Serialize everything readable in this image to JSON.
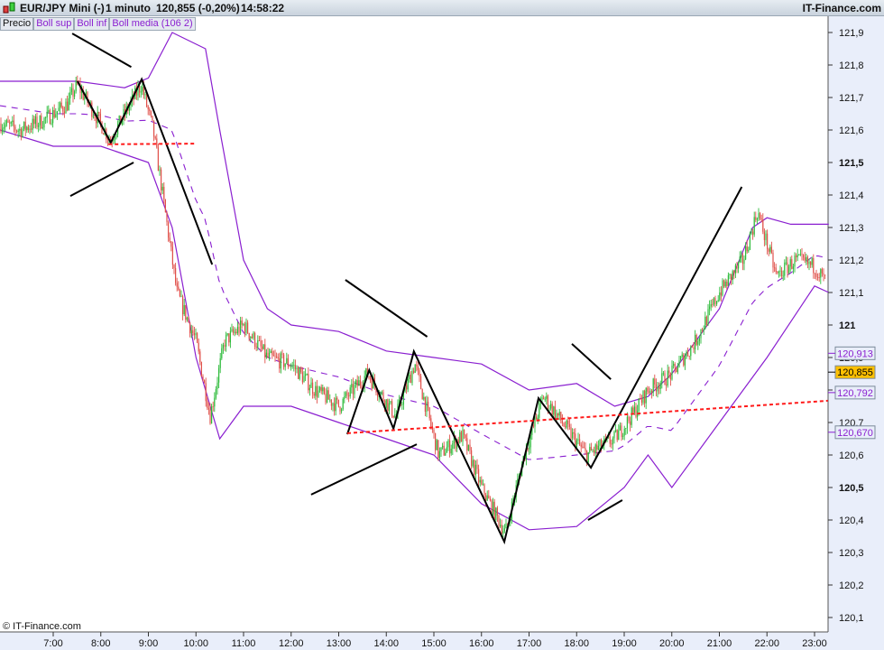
{
  "header": {
    "symbol": "EUR/JPY Mini (-)",
    "timeframe": "1 minuto",
    "price": "120,855 (-0,20%)",
    "time": "14:58:22",
    "brand": "IT-Finance.com"
  },
  "legend": [
    "Precio",
    "Boll sup",
    "Boll inf",
    "Boll media (106 2)"
  ],
  "footer": {
    "copyright": "© IT-Finance.com"
  },
  "colors": {
    "up": "#2dbb3a",
    "down": "#e0504a",
    "band": "#8a1fd0",
    "trend": "#000000",
    "support": "#ff1a1a",
    "last": "#ffc000"
  },
  "chart_data": {
    "type": "candlestick",
    "title": "EUR/JPY Mini (-) 1 minuto",
    "ylim": [
      120.05,
      121.95
    ],
    "xlim": [
      5.88,
      23.3
    ],
    "y_ticks": [
      {
        "v": 121.9,
        "label": "121,9"
      },
      {
        "v": 121.8,
        "label": "121,8"
      },
      {
        "v": 121.7,
        "label": "121,7"
      },
      {
        "v": 121.6,
        "label": "121,6"
      },
      {
        "v": 121.5,
        "label": "121,5",
        "bold": true
      },
      {
        "v": 121.4,
        "label": "121,4"
      },
      {
        "v": 121.3,
        "label": "121,3"
      },
      {
        "v": 121.2,
        "label": "121,2"
      },
      {
        "v": 121.1,
        "label": "121,1"
      },
      {
        "v": 121.0,
        "label": "121",
        "bold": true
      },
      {
        "v": 120.9,
        "label": "120,9"
      },
      {
        "v": 120.8,
        "label": "120,8"
      },
      {
        "v": 120.7,
        "label": "120,7"
      },
      {
        "v": 120.6,
        "label": "120,6"
      },
      {
        "v": 120.5,
        "label": "120,5",
        "bold": true
      },
      {
        "v": 120.4,
        "label": "120,4"
      },
      {
        "v": 120.3,
        "label": "120,3"
      },
      {
        "v": 120.2,
        "label": "120,2"
      },
      {
        "v": 120.1,
        "label": "120,1"
      }
    ],
    "x_ticks": [
      {
        "v": 7,
        "label": "7:00"
      },
      {
        "v": 8,
        "label": "8:00"
      },
      {
        "v": 9,
        "label": "9:00"
      },
      {
        "v": 10,
        "label": "10:00"
      },
      {
        "v": 11,
        "label": "11:00"
      },
      {
        "v": 12,
        "label": "12:00"
      },
      {
        "v": 13,
        "label": "13:00"
      },
      {
        "v": 14,
        "label": "14:00"
      },
      {
        "v": 15,
        "label": "15:00"
      },
      {
        "v": 16,
        "label": "16:00"
      },
      {
        "v": 17,
        "label": "17:00"
      },
      {
        "v": 18,
        "label": "18:00"
      },
      {
        "v": 19,
        "label": "19:00"
      },
      {
        "v": 20,
        "label": "20:00"
      },
      {
        "v": 21,
        "label": "21:00"
      },
      {
        "v": 22,
        "label": "22:00"
      },
      {
        "v": 23,
        "label": "23:00"
      }
    ],
    "price_path": [
      [
        5.9,
        121.62
      ],
      [
        6.3,
        121.6
      ],
      [
        6.8,
        121.63
      ],
      [
        7.3,
        121.68
      ],
      [
        7.5,
        121.74
      ],
      [
        8.2,
        121.57
      ],
      [
        8.85,
        121.74
      ],
      [
        9.1,
        121.6
      ],
      [
        9.3,
        121.4
      ],
      [
        9.6,
        121.1
      ],
      [
        10.0,
        120.95
      ],
      [
        10.3,
        120.72
      ],
      [
        10.6,
        120.95
      ],
      [
        11.0,
        121.0
      ],
      [
        11.5,
        120.9
      ],
      [
        12.0,
        120.88
      ],
      [
        12.5,
        120.8
      ],
      [
        13.0,
        120.75
      ],
      [
        13.6,
        120.85
      ],
      [
        14.2,
        120.72
      ],
      [
        14.6,
        120.88
      ],
      [
        15.1,
        120.6
      ],
      [
        15.6,
        120.66
      ],
      [
        16.0,
        120.5
      ],
      [
        16.5,
        120.36
      ],
      [
        16.9,
        120.6
      ],
      [
        17.3,
        120.78
      ],
      [
        18.2,
        120.6
      ],
      [
        18.8,
        120.65
      ],
      [
        19.2,
        120.73
      ],
      [
        19.5,
        120.8
      ],
      [
        20.0,
        120.85
      ],
      [
        20.5,
        120.95
      ],
      [
        21.0,
        121.1
      ],
      [
        21.5,
        121.2
      ],
      [
        21.8,
        121.35
      ],
      [
        22.2,
        121.15
      ],
      [
        22.6,
        121.2
      ],
      [
        23.0,
        121.18
      ],
      [
        23.3,
        121.12
      ]
    ],
    "boll_upper": [
      [
        5.88,
        121.75
      ],
      [
        7.5,
        121.75
      ],
      [
        8.5,
        121.73
      ],
      [
        9.0,
        121.76
      ],
      [
        9.5,
        121.9
      ],
      [
        10.2,
        121.85
      ],
      [
        10.5,
        121.6
      ],
      [
        11,
        121.2
      ],
      [
        11.5,
        121.05
      ],
      [
        12,
        121.0
      ],
      [
        13,
        120.98
      ],
      [
        14,
        120.92
      ],
      [
        15,
        120.9
      ],
      [
        16,
        120.88
      ],
      [
        17,
        120.8
      ],
      [
        18,
        120.82
      ],
      [
        18.8,
        120.75
      ],
      [
        19.5,
        120.78
      ],
      [
        20,
        120.85
      ],
      [
        21,
        121.05
      ],
      [
        21.7,
        121.3
      ],
      [
        22,
        121.33
      ],
      [
        22.5,
        121.31
      ],
      [
        23.3,
        121.31
      ]
    ],
    "boll_lower": [
      [
        5.88,
        121.6
      ],
      [
        7,
        121.55
      ],
      [
        8,
        121.55
      ],
      [
        9,
        121.5
      ],
      [
        9.5,
        121.3
      ],
      [
        10,
        120.9
      ],
      [
        10.5,
        120.65
      ],
      [
        11,
        120.75
      ],
      [
        12,
        120.75
      ],
      [
        13,
        120.7
      ],
      [
        14,
        120.65
      ],
      [
        15,
        120.6
      ],
      [
        16,
        120.45
      ],
      [
        17,
        120.37
      ],
      [
        18,
        120.38
      ],
      [
        19,
        120.5
      ],
      [
        19.5,
        120.6
      ],
      [
        20,
        120.5
      ],
      [
        21,
        120.7
      ],
      [
        22,
        120.9
      ],
      [
        23,
        121.12
      ],
      [
        23.3,
        121.1
      ]
    ],
    "trendlines": [
      [
        [
          7.4,
          121.897
        ],
        [
          8.64,
          121.794
        ]
      ],
      [
        [
          7.36,
          121.397
        ],
        [
          8.69,
          121.5
        ]
      ],
      [
        [
          7.51,
          121.75
        ],
        [
          8.21,
          121.561
        ],
        [
          8.86,
          121.756
        ],
        [
          10.34,
          121.186
        ]
      ],
      [
        [
          13.14,
          121.139
        ],
        [
          14.86,
          120.964
        ]
      ],
      [
        [
          12.42,
          120.478
        ],
        [
          14.64,
          120.633
        ]
      ],
      [
        [
          13.18,
          120.664
        ],
        [
          13.64,
          120.861
        ],
        [
          14.15,
          120.681
        ],
        [
          14.58,
          120.919
        ],
        [
          16.48,
          120.333
        ],
        [
          17.2,
          120.775
        ],
        [
          18.3,
          120.561
        ],
        [
          21.47,
          121.425
        ]
      ],
      [
        [
          17.9,
          120.942
        ],
        [
          18.72,
          120.833
        ]
      ],
      [
        [
          18.24,
          120.4
        ],
        [
          18.96,
          120.461
        ]
      ]
    ],
    "support_lines": [
      [
        [
          8.16,
          121.556
        ],
        [
          10.01,
          121.558
        ]
      ],
      [
        [
          13.18,
          120.667
        ],
        [
          23.28,
          120.767
        ]
      ]
    ],
    "price_tags": [
      {
        "v": 120.913,
        "label": "120,913",
        "kind": "band"
      },
      {
        "v": 120.855,
        "label": "120,855",
        "kind": "last"
      },
      {
        "v": 120.792,
        "label": "120,792",
        "kind": "band"
      },
      {
        "v": 120.67,
        "label": "120,670",
        "kind": "band"
      }
    ]
  }
}
